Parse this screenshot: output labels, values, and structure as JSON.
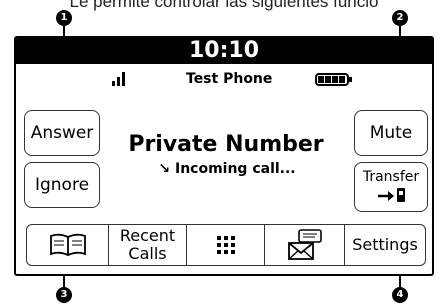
{
  "caption": "Le permite controlar las siguientes funcio",
  "callouts": {
    "c1": "1",
    "c2": "2",
    "c3": "3",
    "c4": "4"
  },
  "titlebar": {
    "time": "10:10"
  },
  "status": {
    "signal_icon": "signal-bars-icon",
    "phone_name": "Test Phone",
    "battery_icon": "battery-icon"
  },
  "left_buttons": {
    "answer": "Answer",
    "ignore": "Ignore"
  },
  "right_buttons": {
    "mute": "Mute",
    "transfer": "Transfer",
    "transfer_icon": "transfer-to-phone-icon"
  },
  "call": {
    "caller": "Private Number",
    "incoming_arrow": "↘",
    "status": "Incoming call..."
  },
  "bottom_bar": {
    "phonebook_icon": "book-icon",
    "recent_calls_line1": "Recent",
    "recent_calls_line2": "Calls",
    "keypad_icon": "keypad-icon",
    "messages_icon": "message-envelope-icon",
    "settings": "Settings"
  }
}
